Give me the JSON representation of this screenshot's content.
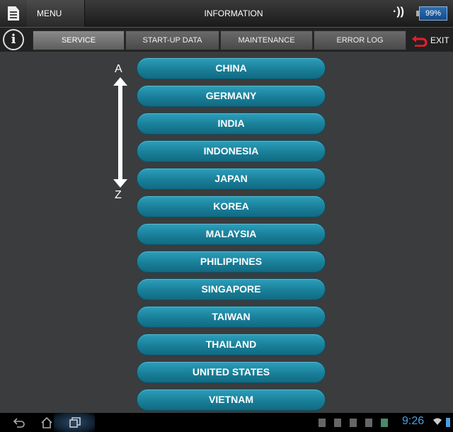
{
  "topbar": {
    "menu_label": "MENU",
    "title": "INFORMATION",
    "signal_icon": "·))",
    "battery": "99%"
  },
  "tabs": {
    "info_symbol": "i",
    "items": [
      {
        "label": "SERVICE",
        "active": true
      },
      {
        "label": "START-UP DATA",
        "active": false
      },
      {
        "label": "MAINTENANCE",
        "active": false
      },
      {
        "label": "ERROR LOG",
        "active": false
      }
    ],
    "exit_label": "EXIT"
  },
  "sort": {
    "start": "A",
    "end": "Z"
  },
  "countries": [
    "CHINA",
    "GERMANY",
    "INDIA",
    "INDONESIA",
    "JAPAN",
    "KOREA",
    "MALAYSIA",
    "PHILIPPINES",
    "SINGAPORE",
    "TAIWAN",
    "THAILAND",
    "UNITED STATES",
    "VIETNAM"
  ],
  "system": {
    "clock": "9:26"
  },
  "colors": {
    "accent": "#1a7f99",
    "exit": "#e0202a",
    "clock": "#4aa0e0"
  }
}
